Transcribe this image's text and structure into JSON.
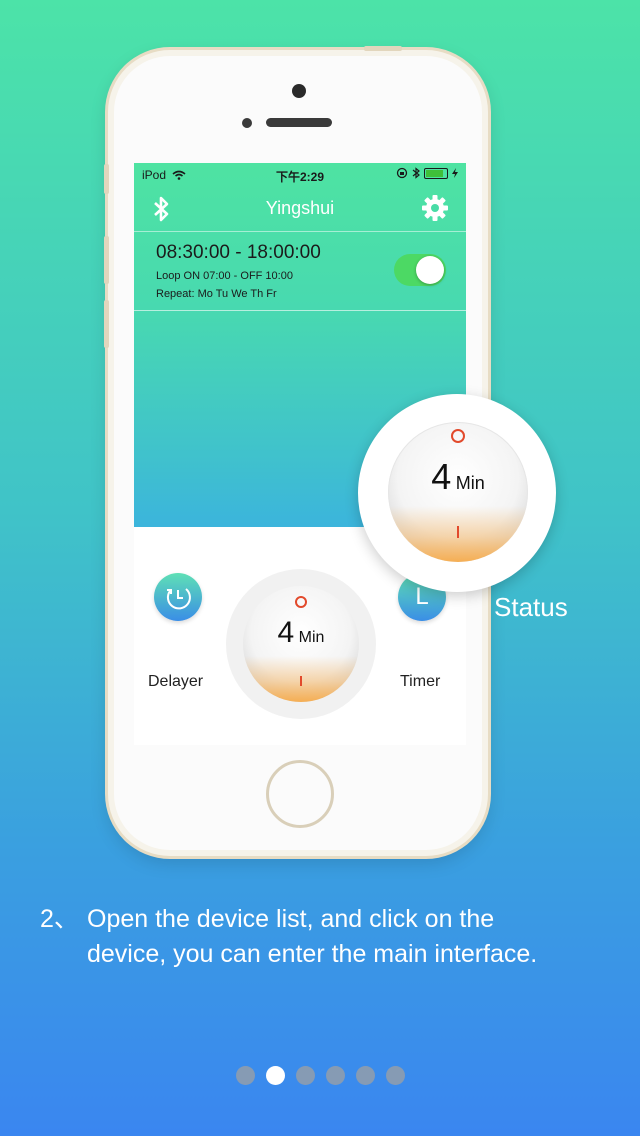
{
  "status_bar": {
    "carrier": "iPod",
    "time": "下午2:29"
  },
  "nav": {
    "title": "Yingshui",
    "left_icon": "bluetooth-icon",
    "right_icon": "gear-icon"
  },
  "schedule": {
    "time_range": "08:30:00 - 18:00:00",
    "loop": "Loop ON 07:00 - OFF 10:00",
    "repeat": "Repeat: Mo Tu We Th Fr",
    "enabled": true
  },
  "controls": {
    "delayer_label": "Delayer",
    "timer_label": "Timer",
    "timer_glyph": "L",
    "dial_value": "4",
    "dial_unit": "Min"
  },
  "callout": {
    "dial_value": "4",
    "dial_unit": "Min",
    "label": "Status"
  },
  "caption": {
    "number": "2、",
    "line1": "Open the device list, and click on the",
    "line2": "device, you can enter the main interface."
  },
  "pager": {
    "count": 6,
    "active_index": 1
  },
  "colors": {
    "accent_red": "#e24a2c",
    "toggle_green": "#4cd964"
  }
}
